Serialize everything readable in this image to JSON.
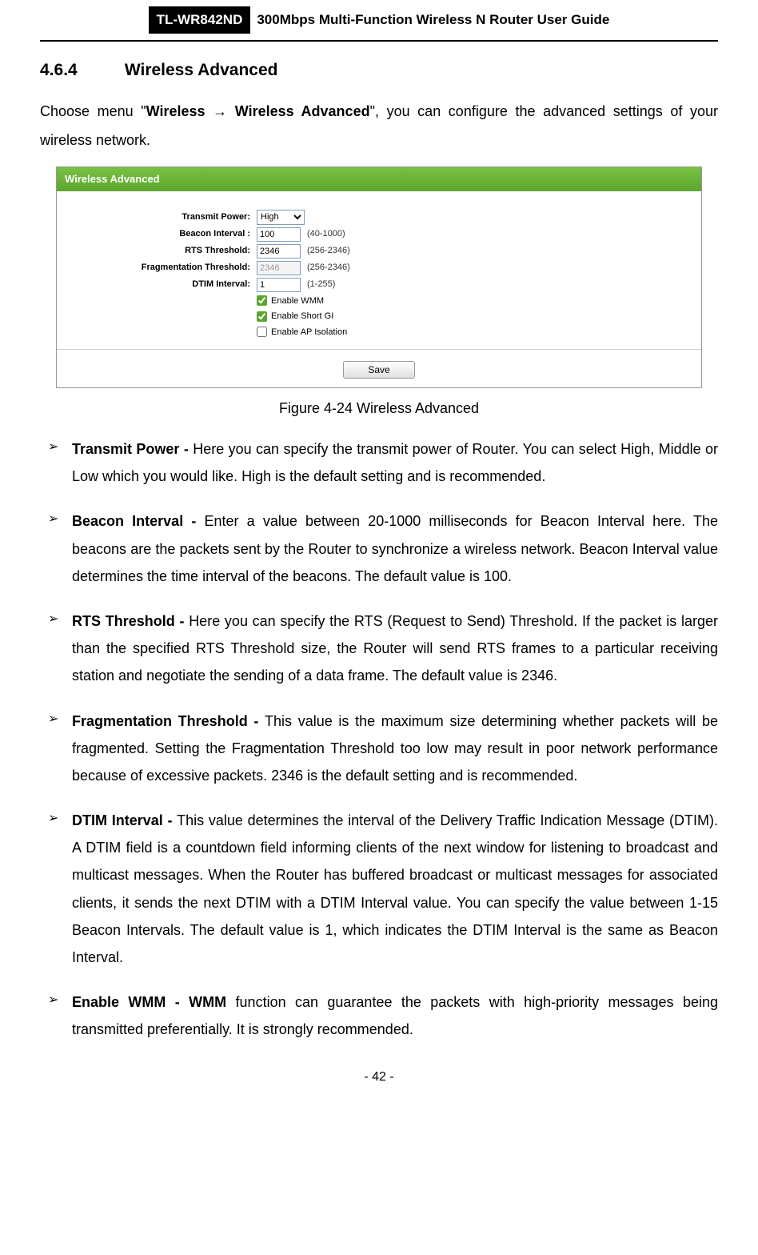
{
  "header": {
    "model": "TL-WR842ND",
    "title": "300Mbps Multi-Function Wireless N Router User Guide"
  },
  "section": {
    "number": "4.6.4",
    "title": "Wireless Advanced"
  },
  "intro": {
    "prefix": "Choose menu \"",
    "menu_bold": "Wireless → Wireless Advanced",
    "suffix": "\", you can configure the advanced settings of your wireless network."
  },
  "panel": {
    "title": "Wireless Advanced",
    "fields": {
      "transmit_power": {
        "label": "Transmit Power:",
        "value": "High"
      },
      "beacon_interval": {
        "label": "Beacon Interval :",
        "value": "100",
        "hint": "(40-1000)"
      },
      "rts_threshold": {
        "label": "RTS Threshold:",
        "value": "2346",
        "hint": "(256-2346)"
      },
      "frag_threshold": {
        "label": "Fragmentation Threshold:",
        "value": "2346",
        "hint": "(256-2346)"
      },
      "dtim_interval": {
        "label": "DTIM Interval:",
        "value": "1",
        "hint": "(1-255)"
      },
      "enable_wmm": {
        "label": "Enable WMM",
        "checked": true
      },
      "enable_short_gi": {
        "label": "Enable Short GI",
        "checked": true
      },
      "enable_ap_isolation": {
        "label": "Enable AP Isolation",
        "checked": false
      }
    },
    "save_button": "Save"
  },
  "figure_caption": "Figure 4-24 Wireless Advanced",
  "bullets": [
    {
      "label": "Transmit Power - ",
      "text": "Here you can specify the transmit power of Router. You can select High, Middle or Low which you would like. High is the default setting and is recommended."
    },
    {
      "label": "Beacon Interval - ",
      "text": "Enter a value between 20-1000 milliseconds for Beacon Interval here. The beacons are the packets sent by the Router to synchronize a wireless network. Beacon Interval value determines the time interval of the beacons. The default value is 100."
    },
    {
      "label": "RTS Threshold - ",
      "text": "Here you can specify the RTS (Request to Send) Threshold. If the packet is larger than the specified RTS Threshold size, the Router will send RTS frames to a particular receiving station and negotiate the sending of a data frame. The default value is 2346."
    },
    {
      "label": "Fragmentation Threshold - ",
      "text": "This value is the maximum size determining whether packets will be fragmented. Setting the Fragmentation Threshold too low may result in poor network performance because of excessive packets. 2346 is the default setting and is recommended."
    },
    {
      "label": "DTIM Interval - ",
      "text": "This value determines the interval of the Delivery Traffic Indication Message (DTIM). A DTIM field is a countdown field informing clients of the next window for listening to broadcast and multicast messages. When the Router has buffered broadcast or multicast messages for associated clients, it sends the next DTIM with a DTIM Interval value. You can specify the value between 1-15 Beacon Intervals. The default value is 1, which indicates the DTIM Interval is the same as Beacon Interval."
    },
    {
      "label": "Enable WMM - WMM ",
      "text": "function can guarantee the packets with high-priority messages being transmitted preferentially. It is strongly recommended."
    }
  ],
  "page_number": "- 42 -"
}
